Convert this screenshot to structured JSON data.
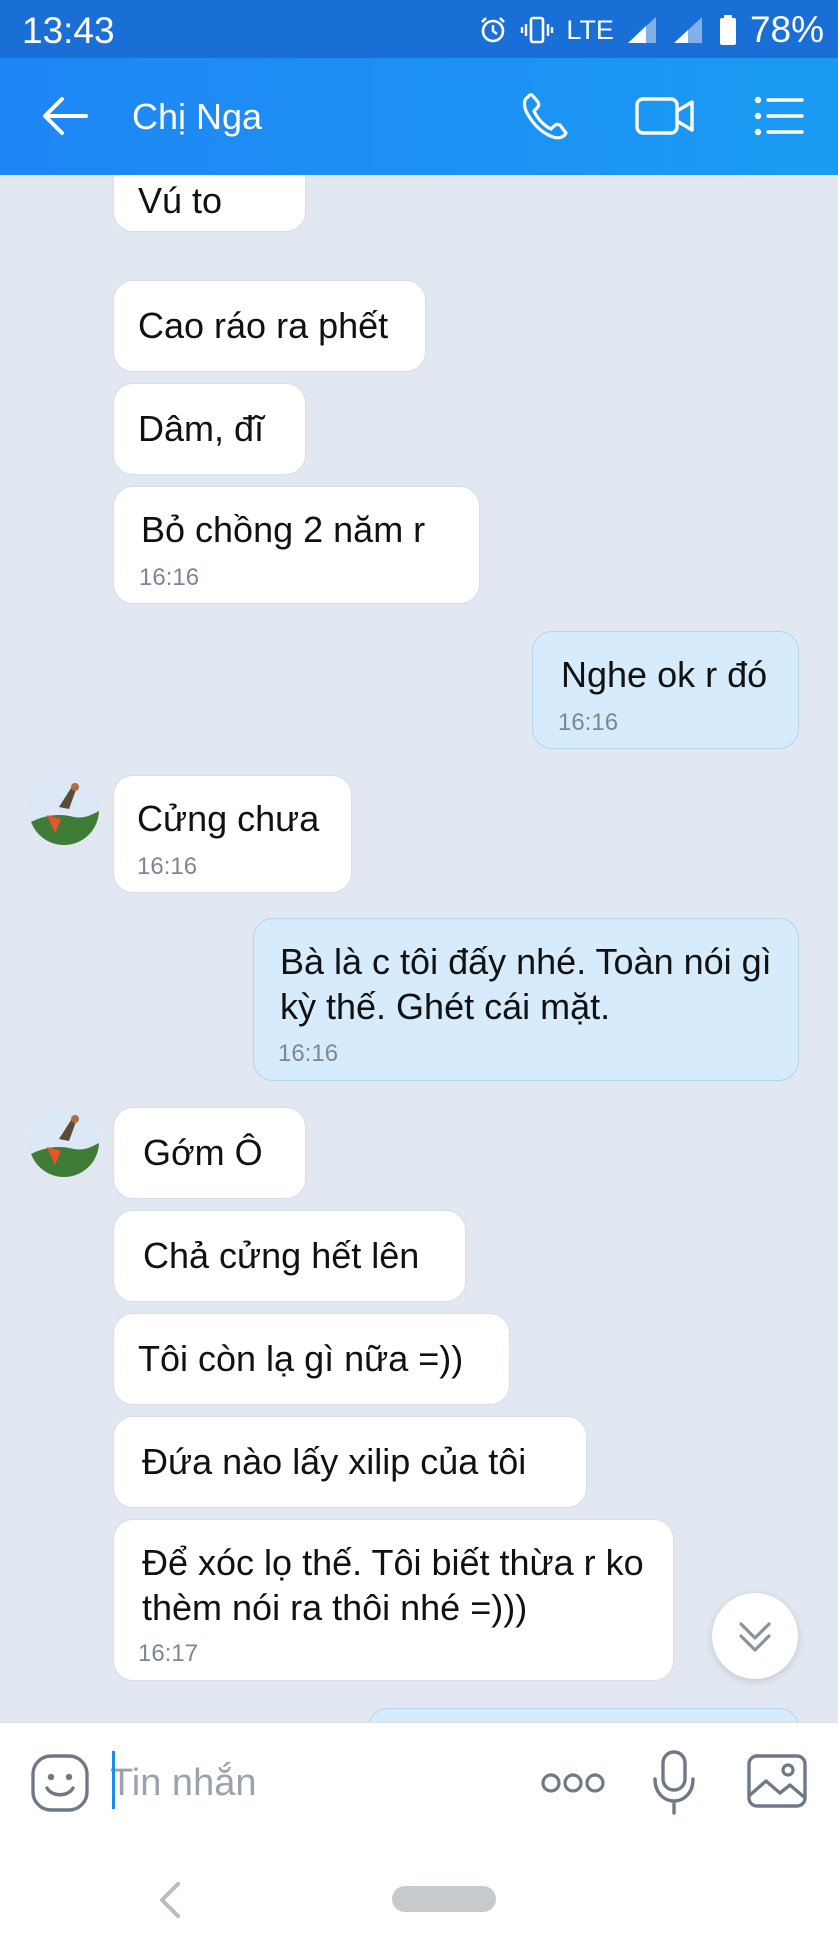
{
  "status_bar": {
    "time": "13:43",
    "network": "LTE",
    "battery": "78%",
    "icons": [
      "alarm-icon",
      "vibrate-icon",
      "signal-icon",
      "signal-icon",
      "battery-icon"
    ]
  },
  "header": {
    "contact_name": "Chị Nga",
    "icons": [
      "back-arrow-icon",
      "phone-icon",
      "video-call-icon",
      "menu-list-icon"
    ],
    "colors": {
      "start": "#1f86f5",
      "end": "#1a9bf3"
    }
  },
  "messages": [
    {
      "side": "in",
      "text": "Vú to"
    },
    {
      "side": "in",
      "text": "Cao ráo ra phết"
    },
    {
      "side": "in",
      "text": "Dâm, đĩ"
    },
    {
      "side": "in",
      "text": "Bỏ chồng 2 năm r",
      "time": "16:16"
    },
    {
      "side": "out",
      "text": "Nghe ok r đó",
      "time": "16:16"
    },
    {
      "side": "in",
      "text": "Cửng chưa",
      "time": "16:16",
      "avatar": true
    },
    {
      "side": "out",
      "text": "Bà là c tôi đấy nhé. Toàn nói gì kỳ thế. Ghét cái mặt.",
      "time": "16:16"
    },
    {
      "side": "in",
      "text": "Gớm Ô",
      "avatar": true
    },
    {
      "side": "in",
      "text": "Chả cửng hết lên"
    },
    {
      "side": "in",
      "text": "Tôi còn lạ gì nữa =))"
    },
    {
      "side": "in",
      "text": "Đứa nào lấy xilip của tôi"
    },
    {
      "side": "in",
      "text": "Để xóc lọ thế. Tôi biết thừa r ko thèm nói ra thôi nhé =)))",
      "time": "16:17"
    }
  ],
  "scroll_button": {
    "icon": "double-chevron-down-icon"
  },
  "input_bar": {
    "placeholder": "Tin nhắn",
    "icons": [
      "emoji-icon",
      "more-options-icon",
      "microphone-icon",
      "image-icon"
    ]
  },
  "nav_bar": {
    "icons": [
      "nav-back-icon",
      "home-pill-icon"
    ]
  },
  "colors": {
    "chat_background": "#e2e8f1",
    "incoming_bubble": "#ffffff",
    "outgoing_bubble": "#d6ecfc",
    "status_bar": "#1a6fd6",
    "accent": "#1a8cf0"
  }
}
